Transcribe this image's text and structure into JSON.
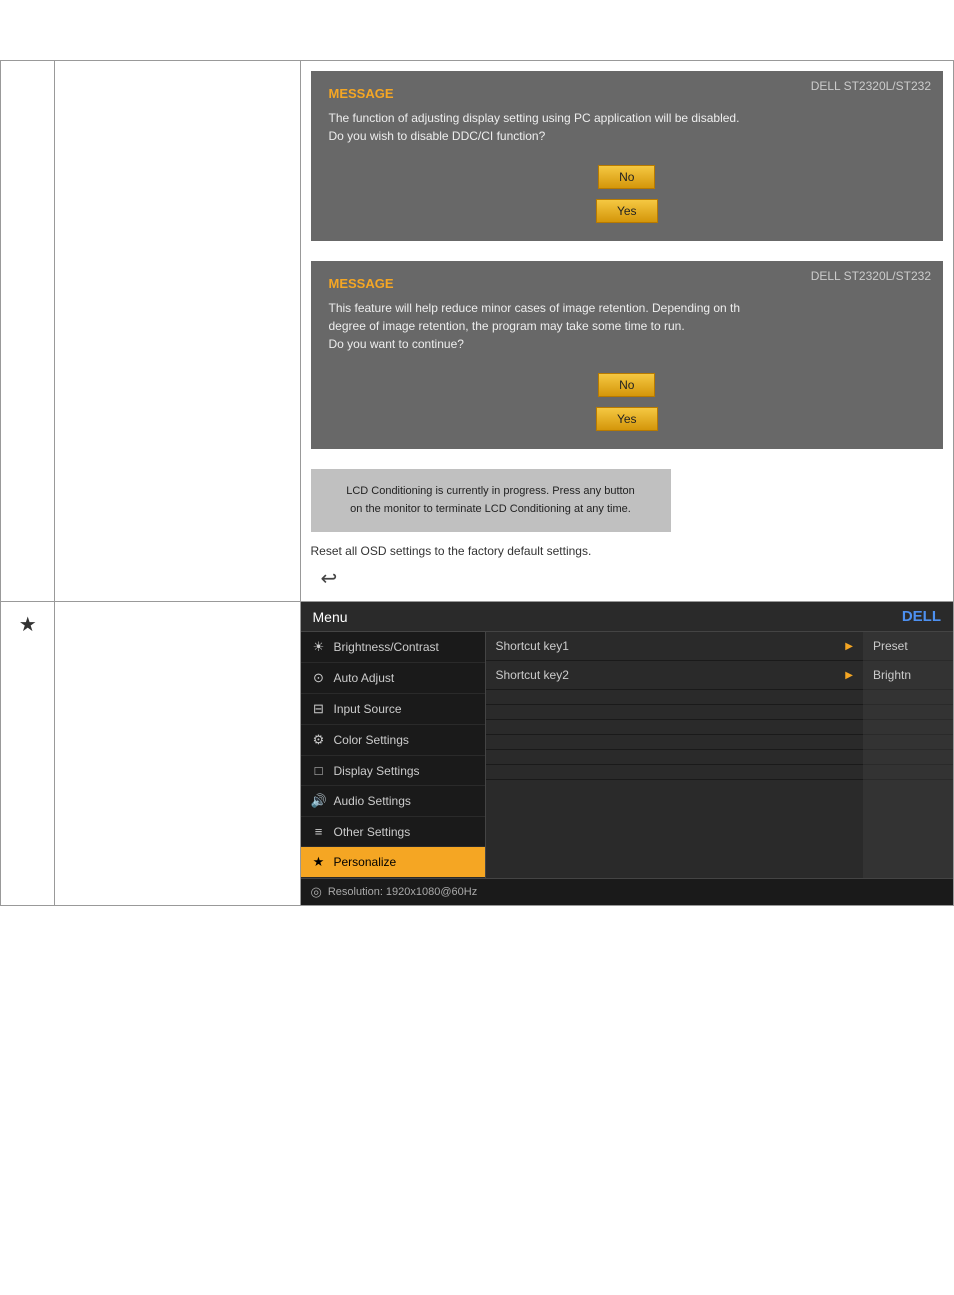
{
  "top_section": {
    "dialog1": {
      "brand": "DELL  ST2320L/ST232",
      "title": "MESSAGE",
      "body_line1": "The function of adjusting display setting using PC application will be disabled.",
      "body_line2": "Do you wish to disable DDC/CI function?",
      "btn_no": "No",
      "btn_yes": "Yes"
    },
    "dialog2": {
      "brand": "DELL  ST2320L/ST232",
      "title": "MESSAGE",
      "body_line1": "This feature will help reduce minor cases of image retention. Depending on th",
      "body_line2": "degree of image retention, the program may take some time to run.",
      "body_line3": "Do you want to continue?",
      "btn_no": "No",
      "btn_yes": "Yes"
    },
    "lcd_box": {
      "line1": "LCD Conditioning is currently in progress. Press any button",
      "line2": "on the monitor to terminate LCD Conditioning at any time."
    },
    "reset_text": "Reset all OSD settings to the factory default settings.",
    "reset_icon": "↩"
  },
  "bottom_section": {
    "star": "★",
    "menu": {
      "header_label": "Menu",
      "header_brand": "DELL",
      "items": [
        {
          "icon": "☀",
          "label": "Brightness/Contrast"
        },
        {
          "icon": "⊙",
          "label": "Auto Adjust"
        },
        {
          "icon": "⊟",
          "label": "Input Source"
        },
        {
          "icon": "⚙",
          "label": "Color Settings"
        },
        {
          "icon": "□",
          "label": "Display Settings"
        },
        {
          "icon": "🔊",
          "label": "Audio Settings"
        },
        {
          "icon": "≡",
          "label": "Other Settings"
        },
        {
          "icon": "★",
          "label": "Personalize",
          "active": true
        }
      ],
      "middle_items": [
        {
          "label": "Shortcut key1",
          "value": "Preset"
        },
        {
          "label": "Shortcut key2",
          "value": "Brightn"
        }
      ],
      "footer_icon": "◎",
      "footer_text": "Resolution:  1920x1080@60Hz"
    }
  }
}
